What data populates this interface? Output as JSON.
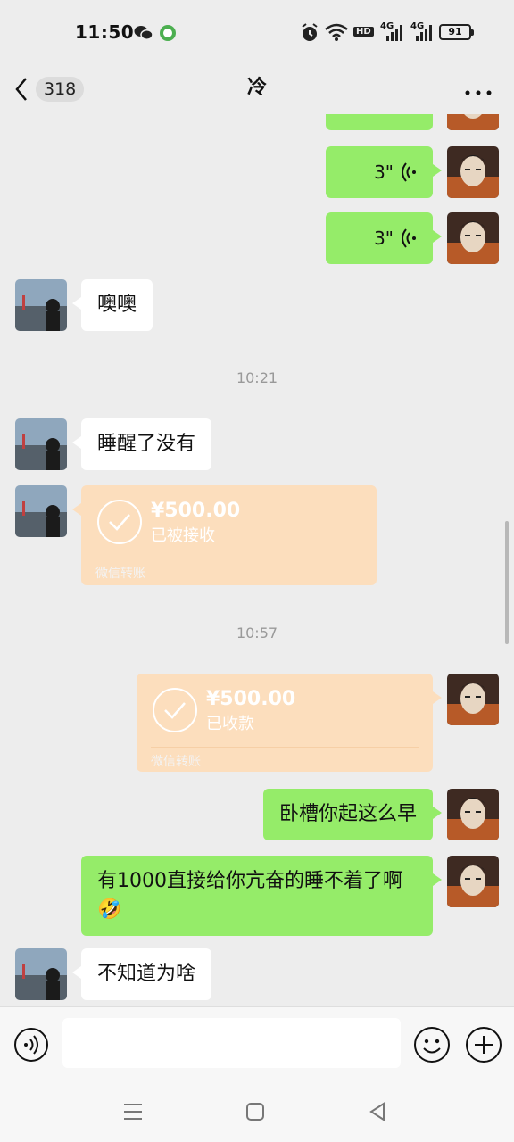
{
  "status_bar": {
    "time": "11:50",
    "icons": [
      "wechat-icon",
      "game-icon",
      "alarm-icon",
      "wifi-icon",
      "hd-icon",
      "signal-4g-icon",
      "signal-4g-icon",
      "battery-icon"
    ],
    "hd_label": "HD",
    "net_label_1": "4G",
    "net_label_2": "4G",
    "battery": "91"
  },
  "header": {
    "unread_count": "318",
    "title": "冷"
  },
  "messages": {
    "voice_1": "3\"",
    "voice_2": "3\"",
    "text_1": "噢噢",
    "time_1": "10:21",
    "text_2": "睡醒了没有",
    "transfer_1": {
      "amount": "¥500.00",
      "status": "已被接收",
      "label": "微信转账"
    },
    "time_2": "10:57",
    "transfer_2": {
      "amount": "¥500.00",
      "status": "已收款",
      "label": "微信转账"
    },
    "text_3": "卧槽你起这么早",
    "text_4": "有1000直接给你亢奋的睡不着了啊",
    "text_4_emoji": "🤣",
    "text_5": "不知道为啥"
  },
  "colors": {
    "sent_bubble": "#95ec69",
    "received_bubble": "#ffffff",
    "transfer_bubble": "#fcdebd",
    "background": "#ededed"
  }
}
